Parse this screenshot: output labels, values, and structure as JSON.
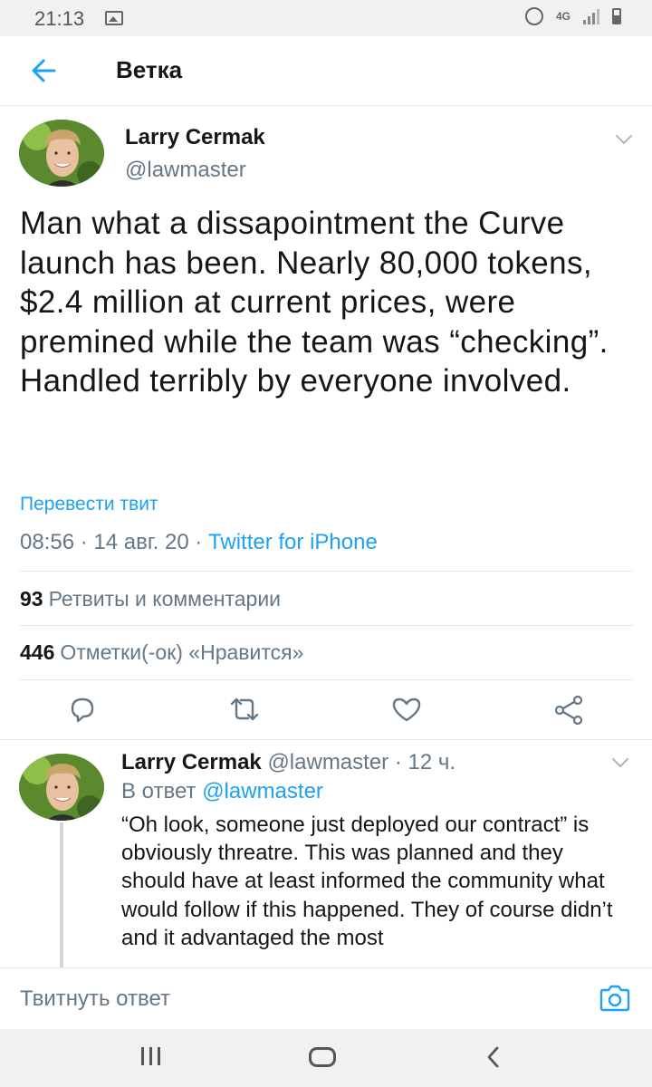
{
  "status_bar": {
    "time": "21:13",
    "network": "4G",
    "icons": [
      "gallery-icon",
      "alarm-icon",
      "signal-icon",
      "battery-icon"
    ]
  },
  "header": {
    "title": "Ветка",
    "back_icon": "arrow-left-icon"
  },
  "tweet": {
    "author_name": "Larry Cermak",
    "author_handle": "@lawmaster",
    "text": "Man what a dissapointment the Curve launch has been. Nearly 80,000 tokens, $2.4 million at current prices, were premined while the team was “checking”. Handled terribly by everyone involved.",
    "translate_label": "Перевести твит",
    "time": "08:56",
    "date": "14 авг. 20",
    "source": "Twitter for iPhone",
    "retweets_count": "93",
    "retweets_label": "Ретвиты и комментарии",
    "likes_count": "446",
    "likes_label": "Отметки(-ок) «Нравится»",
    "actions": [
      "reply-icon",
      "retweet-icon",
      "like-icon",
      "share-icon"
    ]
  },
  "reply": {
    "author_name": "Larry Cermak",
    "author_handle": "@lawmaster",
    "age": "12 ч.",
    "in_reply_prefix": "В ответ",
    "in_reply_handle": "@lawmaster",
    "text": "“Oh look, someone just deployed our contract” is obviously threatre. This was planned and they should have at least informed the community what would follow if this happened. They of course didn’t and it advantaged the most"
  },
  "composer": {
    "placeholder": "Твитнуть ответ"
  },
  "colors": {
    "accent": "#1da1f2",
    "secondary_text": "#657786",
    "divider": "#e1e8ed"
  }
}
